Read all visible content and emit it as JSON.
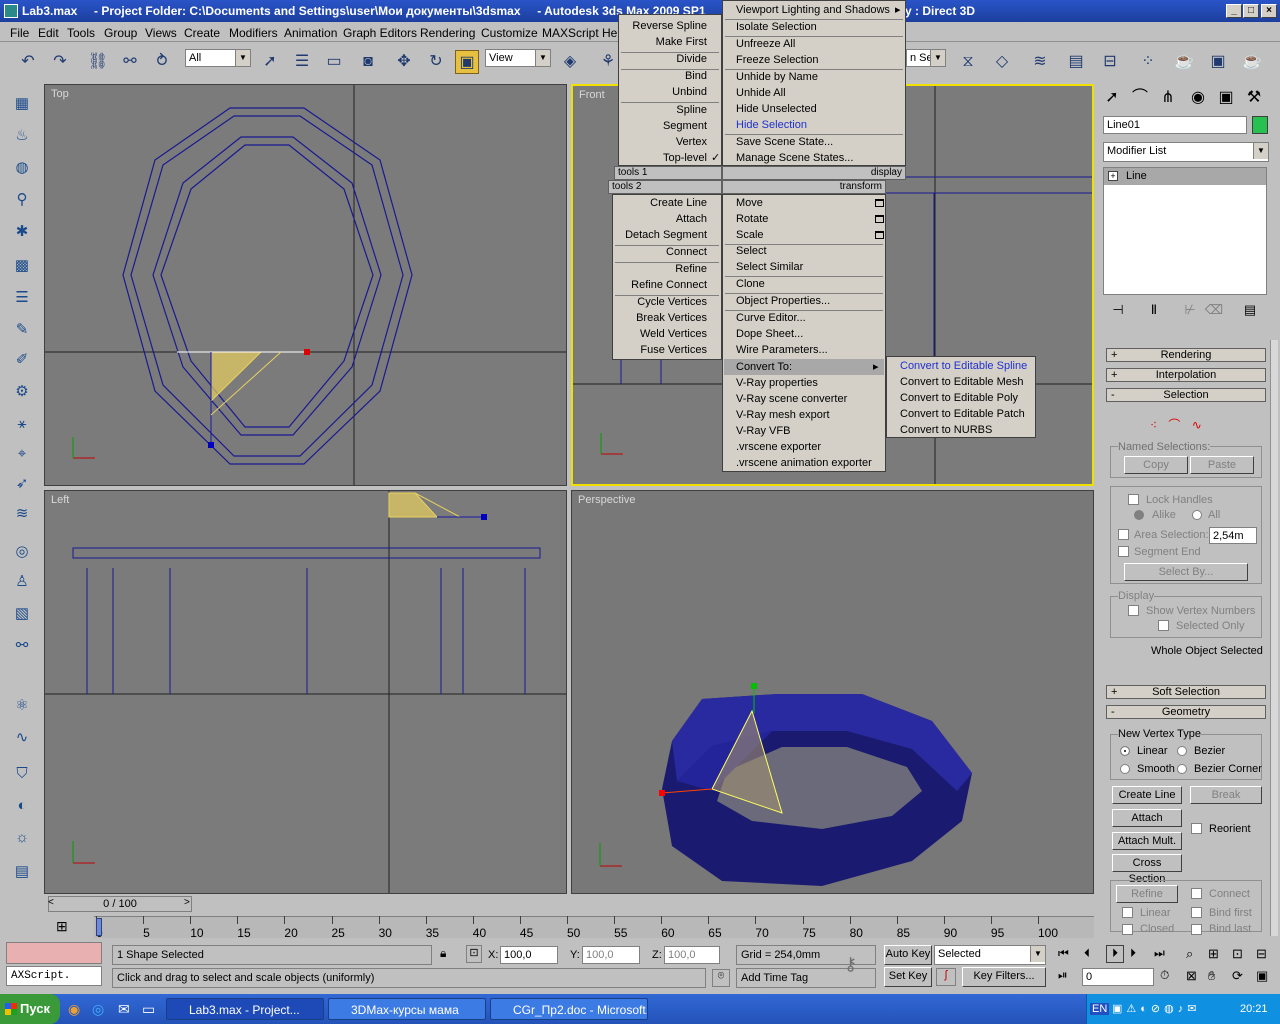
{
  "window": {
    "title": "Lab3.max     - Project Folder: C:\\Documents and Settings\\user\\Мои документы\\3dsmax     - Autodesk 3ds Max 2009 SP1",
    "title_right": "y : Direct 3D",
    "minimize": "_",
    "maximize": "□",
    "close": "×"
  },
  "menubar": [
    "File",
    "Edit",
    "Tools",
    "Group",
    "Views",
    "Create",
    "Modifiers",
    "Animation",
    "Graph Editors",
    "Rendering",
    "Customize",
    "MAXScript",
    "Hel"
  ],
  "toolbar": {
    "filter": "All",
    "coord": "View",
    "named_set": "n Set"
  },
  "viewports": {
    "top": "Top",
    "front": "Front",
    "left": "Left",
    "perspective": "Perspective"
  },
  "quad_left": {
    "items": [
      "Reverse Spline",
      "Make First",
      "Divide",
      "Bind",
      "Unbind",
      "Spline",
      "Segment",
      "Vertex",
      "Top-level"
    ],
    "check": "✓",
    "header1": "tools 1",
    "header2": "tools 2",
    "items2": [
      "Create Line",
      "Attach",
      "Detach Segment",
      "Connect",
      "Refine",
      "Refine Connect",
      "Cycle Vertices",
      "Break Vertices",
      "Weld Vertices",
      "Fuse Vertices"
    ]
  },
  "quad_right": {
    "items": [
      "Viewport Lighting and Shadows",
      "Isolate Selection",
      "Unfreeze All",
      "Freeze Selection",
      "Unhide by Name",
      "Unhide All",
      "Hide Unselected",
      "Hide Selection",
      "Save Scene State...",
      "Manage Scene States..."
    ],
    "header1": "display",
    "header2": "transform",
    "items2": [
      "Move",
      "Rotate",
      "Scale",
      "Select",
      "Select Similar",
      "Clone",
      "Object Properties...",
      "Curve Editor...",
      "Dope Sheet...",
      "Wire Parameters...",
      "Convert To:",
      "V-Ray properties",
      "V-Ray scene converter",
      "V-Ray mesh export",
      "V-Ray VFB",
      ".vrscene exporter",
      ".vrscene animation exporter"
    ]
  },
  "submenu": [
    "Convert to Editable Spline",
    "Convert to Editable Mesh",
    "Convert to Editable Poly",
    "Convert to Editable Patch",
    "Convert to NURBS"
  ],
  "cmd": {
    "object_name": "Line01",
    "modifier_list": "Modifier List",
    "stack_item": "Line",
    "rollouts": {
      "rendering": "Rendering",
      "interpolation": "Interpolation",
      "selection": "Selection",
      "soft_selection": "Soft Selection",
      "geometry": "Geometry"
    },
    "named_selections": "Named Selections:",
    "copy": "Copy",
    "paste": "Paste",
    "lock_handles": "Lock Handles",
    "alike": "Alike",
    "all": "All",
    "area_selection": "Area Selection:",
    "area_value": "2,54m",
    "segment_end": "Segment End",
    "select_by": "Select By...",
    "display": "Display",
    "show_vertex_numbers": "Show Vertex Numbers",
    "selected_only": "Selected Only",
    "whole_object": "Whole Object Selected",
    "new_vertex_type": "New Vertex Type",
    "linear": "Linear",
    "bezier": "Bezier",
    "smooth": "Smooth",
    "bezier_corner": "Bezier Corner",
    "create_line": "Create Line",
    "break": "Break",
    "attach": "Attach",
    "reorient": "Reorient",
    "attach_mult": "Attach Mult.",
    "cross_section": "Cross Section",
    "refine": "Refine",
    "connect": "Connect",
    "linear2": "Linear",
    "bind_first": "Bind first",
    "closed": "Closed",
    "bind_last": "Bind last"
  },
  "timeline": {
    "counter": "0 / 100",
    "ticks": [
      "0",
      "5",
      "10",
      "15",
      "20",
      "25",
      "30",
      "35",
      "40",
      "45",
      "50",
      "55",
      "60",
      "65",
      "70",
      "75",
      "80",
      "85",
      "90",
      "95",
      "100"
    ]
  },
  "status": {
    "maxscript": "AXScript.",
    "selected_count": "1 Shape Selected",
    "prompt": "Click and drag to select and scale objects (uniformly)",
    "x_label": "X:",
    "x": "100,0",
    "y_label": "Y:",
    "y": "100,0",
    "z_label": "Z:",
    "z": "100,0",
    "grid": "Grid = 254,0mm",
    "add_time_tag": "Add Time Tag",
    "auto_key": "Auto Key",
    "set_key": "Set Key",
    "selected": "Selected",
    "key_filters": "Key Filters...",
    "frame": "0"
  },
  "taskbar": {
    "start": "Пуск",
    "tasks": [
      "Lab3.max     - Project...",
      "3DMax-курсы мама",
      "CGr_Пр2.doc - Microsoft..."
    ],
    "lang": "EN",
    "clock": "20:21"
  }
}
